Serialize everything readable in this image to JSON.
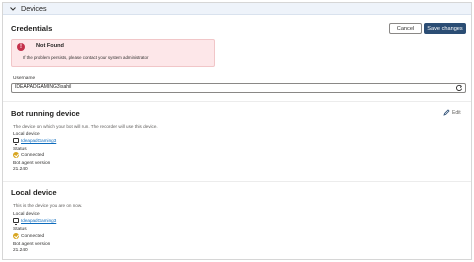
{
  "section": {
    "title": "Devices"
  },
  "credentials": {
    "title": "Credentials",
    "cancel_label": "Cancel",
    "save_label": "Save changes",
    "error": {
      "title": "Not Found",
      "message": "If the problem persists, please contact your system administrator"
    },
    "username_label": "Username",
    "username_value": "IDEAPADGAMING3\\sahil"
  },
  "bot_running_device": {
    "title": "Bot running device",
    "edit_label": "Edit",
    "description": "The device on which your bot will run. The recorder will use this device.",
    "device_label": "Local device",
    "device_name": "IdeapadGaming3",
    "status_label": "Status",
    "status_value": "Connected",
    "agent_version_label": "Bot agent version",
    "agent_version_value": "21.240"
  },
  "local_device": {
    "title": "Local device",
    "description": "This is the device you are on now.",
    "device_label": "Local device",
    "device_name": "IdeapadGaming3",
    "status_label": "Status",
    "status_value": "Connected",
    "agent_version_label": "Bot agent version",
    "agent_version_value": "21.240"
  },
  "colors": {
    "primary_button": "#2b4d74",
    "error_bg": "#fde7e9",
    "error_icon": "#c4314b",
    "status_icon": "#d8a51e",
    "link": "#0f6cbd"
  },
  "icons": {
    "section_toggle": "chevron-down-icon",
    "error": "error-circle-icon",
    "refresh": "refresh-icon",
    "edit": "pencil-icon",
    "device": "computer-icon",
    "status": "check-circle-icon"
  }
}
